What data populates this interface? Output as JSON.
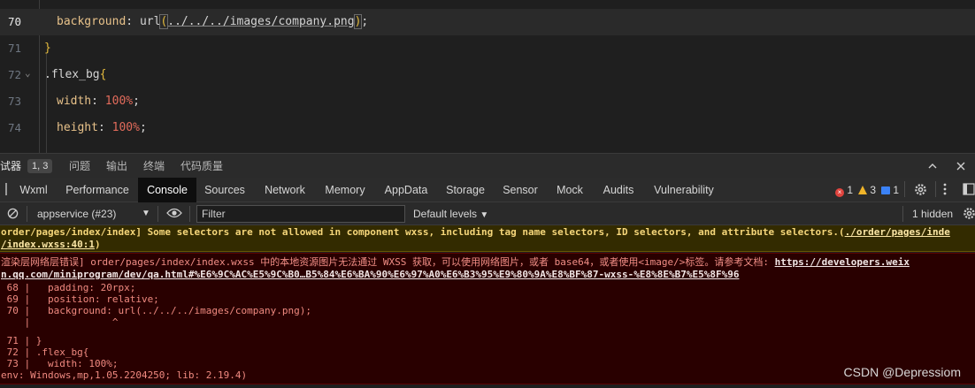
{
  "editor": {
    "lines": [
      {
        "num": "70",
        "prop": "background",
        "value_prefix": "url",
        "value_arg": "../../../images/company.png",
        "suffix": ";"
      },
      {
        "num": "71",
        "text": "}"
      },
      {
        "num": "72",
        "selector": ".flex_bg",
        "brace": "{"
      },
      {
        "num": "73",
        "prop": "width",
        "value": "100%",
        "suffix": ";"
      },
      {
        "num": "74",
        "prop": "height",
        "value": "100%",
        "suffix": ";"
      }
    ]
  },
  "debugger_header": {
    "title_partial": "试器",
    "badge": "1, 3",
    "tabs": [
      "问题",
      "输出",
      "终端",
      "代码质量"
    ]
  },
  "devtools": {
    "tabs": [
      "Wxml",
      "Performance",
      "Console",
      "Sources",
      "Network",
      "Memory",
      "AppData",
      "Storage",
      "Sensor",
      "Mock",
      "Audits",
      "Vulnerability"
    ],
    "active_tab": "Console",
    "errors": "1",
    "warnings": "3",
    "infos": "1"
  },
  "console_toolbar": {
    "context": "appservice (#23)",
    "filter_placeholder": "Filter",
    "levels": "Default levels",
    "hidden": "1 hidden"
  },
  "messages": {
    "warning_line1_a": "order/pages/index/index] Some selectors are not allowed in component wxss, including tag name selectors, ID selectors, and attribute selectors.(",
    "warning_line1_link": "./order/pages/inde",
    "warning_line2_link": "/index.wxss:40:1",
    "warning_line2_b": ")",
    "error_line1_a": "渲染层网络层错误] order/pages/index/index.wxss 中的本地资源图片无法通过 WXSS 获取，可以使用网络图片，或者 base64，或者使用<image/>标签。请参考文档: ",
    "error_line1_link": "https://developers.weix",
    "error_line2_link": "n.qq.com/miniprogram/dev/qa.html#%E6%9C%AC%E5%9C%B0…B5%84%E6%BA%90%E6%97%A0%E6%B3%95%E9%80%9A%E8%BF%87-wxss-%E8%8E%B7%E5%8F%96",
    "code_frame": [
      " 68 |   padding: 20rpx;",
      " 69 |   position: relative;",
      " 70 |   background: url(../../../images/company.png);",
      "    |              ^",
      " 71 | }",
      " 72 | .flex_bg{",
      " 73 |   width: 100%;"
    ],
    "env": "env: Windows,mp,1.05.2204250; lib: 2.19.4)"
  },
  "watermark": "CSDN @Depressiom",
  "colors": {
    "accent_error": "#e0443e",
    "accent_warning": "#f0b429",
    "accent_info": "#3b82f6"
  }
}
